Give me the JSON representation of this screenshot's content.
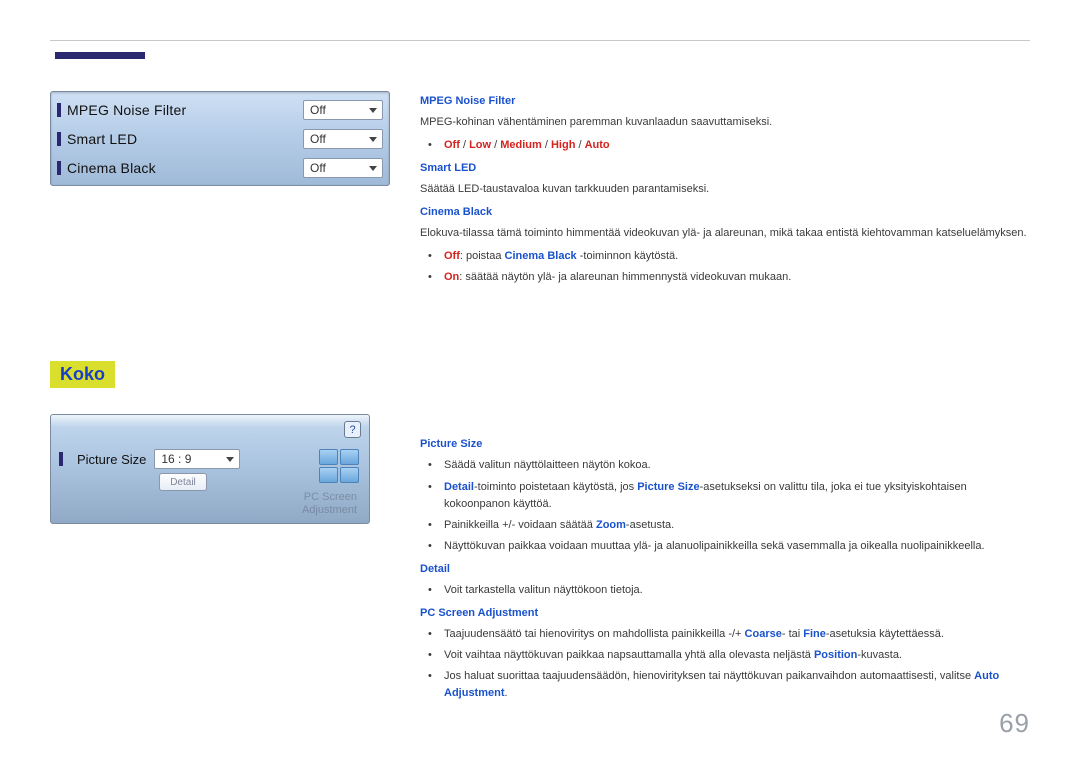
{
  "osd": {
    "rows": [
      {
        "label": "MPEG Noise Filter",
        "value": "Off"
      },
      {
        "label": "Smart LED",
        "value": "Off"
      },
      {
        "label": "Cinema Black",
        "value": "Off"
      }
    ]
  },
  "section_heading": "Koko",
  "panel2": {
    "help": "?",
    "label": "Picture Size",
    "value": "16 : 9",
    "detail_btn": "Detail",
    "faded1": "PC Screen",
    "faded2": "Adjustment"
  },
  "r1": {
    "mpeg_h": "MPEG Noise Filter",
    "mpeg_p": "MPEG-kohinan vähentäminen paremman kuvanlaadun saavuttamiseksi.",
    "mpeg_opts": {
      "off": "Off",
      "low": "Low",
      "medium": "Medium",
      "high": "High",
      "auto": "Auto",
      "sep": " / "
    },
    "sled_h": "Smart LED",
    "sled_p": "Säätää LED-taustavaloa kuvan tarkkuuden parantamiseksi.",
    "cb_h": "Cinema Black",
    "cb_p": "Elokuva-tilassa tämä toiminto himmentää videokuvan ylä- ja alareunan, mikä takaa entistä kiehtovamman katseluelämyksen.",
    "cb_off_k": "Off",
    "cb_off_mid": ": poistaa ",
    "cb_off_name": "Cinema Black",
    "cb_off_tail": " -toiminnon käytöstä.",
    "cb_on_k": "On",
    "cb_on_rest": ": säätää näytön ylä- ja alareunan himmennystä videokuvan mukaan."
  },
  "r2": {
    "ps_h": "Picture Size",
    "ps_b1": "Säädä valitun näyttölaitteen näytön kokoa.",
    "ps_b2_a": "Detail",
    "ps_b2_b": "-toiminto poistetaan käytöstä, jos ",
    "ps_b2_c": "Picture Size",
    "ps_b2_d": "-asetukseksi on valittu tila, joka ei tue yksityiskohtaisen kokoonpanon käyttöä.",
    "ps_b3_a": "Painikkeilla +/- voidaan säätää ",
    "ps_b3_b": "Zoom",
    "ps_b3_c": "-asetusta.",
    "ps_b4": "Näyttökuvan paikkaa voidaan muuttaa ylä- ja alanuolipainikkeilla sekä vasemmalla ja oikealla nuolipainikkeella.",
    "dt_h": "Detail",
    "dt_b1": "Voit tarkastella valitun näyttökoon tietoja.",
    "pcs_h": "PC Screen Adjustment",
    "pcs_b1_a": "Taajuudensäätö tai hienoviritys on mahdollista painikkeilla -/+ ",
    "pcs_b1_b": "Coarse",
    "pcs_b1_c": "- tai ",
    "pcs_b1_d": "Fine",
    "pcs_b1_e": "-asetuksia käytettäessä.",
    "pcs_b2_a": "Voit vaihtaa näyttökuvan paikkaa napsauttamalla yhtä alla olevasta neljästä ",
    "pcs_b2_b": "Position",
    "pcs_b2_c": "-kuvasta.",
    "pcs_b3_a": "Jos haluat suorittaa taajuudensäädön, hienovirityksen tai näyttökuvan paikanvaihdon automaattisesti, valitse ",
    "pcs_b3_b": "Auto Adjustment",
    "pcs_b3_c": "."
  },
  "page_number": "69"
}
